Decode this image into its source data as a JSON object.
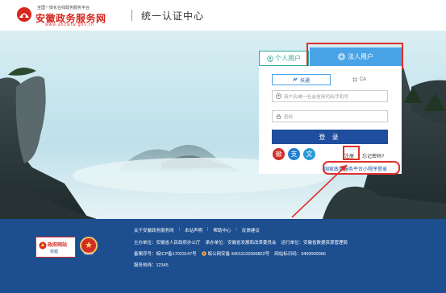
{
  "header": {
    "logo_subtitle": "全国一体化在线政务服务平台",
    "logo_name": "安徽政务服务网",
    "logo_url": "www.ahzwfw.gov.cn",
    "title": "统一认证中心"
  },
  "login": {
    "tab_personal": "个人用户",
    "tab_legal": "法人用户",
    "method_tabs": [
      "扶通",
      "CA"
    ],
    "username_placeholder": "用户名/统一社会信用代码/手机号",
    "password_placeholder": "密码",
    "login_button": "登  录",
    "quick_icon_labels": [
      "徽",
      "支",
      "文"
    ],
    "register": "注册",
    "forgot": "忘记密码?",
    "miniapp": "国家政务服务平台小程序登录"
  },
  "footer": {
    "links": [
      "关于安徽政务服务网",
      "本站声明",
      "帮助中心",
      "反馈建议"
    ],
    "org": [
      "主办单位：安徽省人民政府办公厅",
      "承办单位：安徽省发展和改革委员会",
      "运行单位：安徽省数据资源管理局"
    ],
    "records": [
      "备案序号：皖ICP备17023147号",
      "皖公网安备 34011102000822号",
      "网站标识码：3400000066"
    ],
    "hotline": "服务热线：12345",
    "badge1_title": "政府网站",
    "badge1_sub": "找错",
    "badge2_label": "党政机关"
  },
  "colors": {
    "brand_red": "#d7261e",
    "tab_teal": "#2fae9b",
    "tab_blue": "#4aa3e6",
    "button_navy": "#1f4e9e",
    "footer_bg": "#1d4e8f",
    "highlight_red": "#e0302c"
  }
}
